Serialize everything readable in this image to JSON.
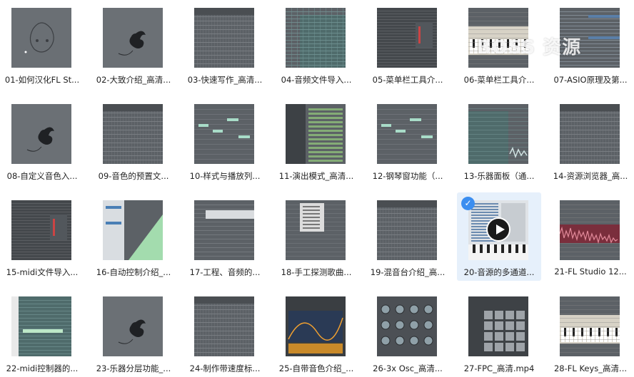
{
  "files": [
    {
      "name": "01-如何汉化FL St...",
      "thumb": "sketch"
    },
    {
      "name": "02-大致介绍_高清...",
      "thumb": "fruit"
    },
    {
      "name": "03-快速写作_高清...",
      "thumb": "tracks"
    },
    {
      "name": "04-音频文件导入...",
      "thumb": "teal-grid"
    },
    {
      "name": "05-菜单栏工具介...",
      "thumb": "mixer"
    },
    {
      "name": "06-菜单栏工具介...",
      "thumb": "keyboard"
    },
    {
      "name": "07-ASIO原理及第...",
      "thumb": "tracks-blue"
    },
    {
      "name": "08-自定义音色入...",
      "thumb": "fruit"
    },
    {
      "name": "09-音色的预置文...",
      "thumb": "tracks"
    },
    {
      "name": "10-样式与播放列...",
      "thumb": "notes"
    },
    {
      "name": "11-演出模式_高清...",
      "thumb": "browser"
    },
    {
      "name": "12-钢琴窗功能（...",
      "thumb": "notes"
    },
    {
      "name": "13-乐器面板（通...",
      "thumb": "teal-wave"
    },
    {
      "name": "14-资源浏览器_高...",
      "thumb": "tracks"
    },
    {
      "name": "15-midi文件导入...",
      "thumb": "mixer"
    },
    {
      "name": "16-自动控制介绍_...",
      "thumb": "automation"
    },
    {
      "name": "17-工程、音频的...",
      "thumb": "tracks-white"
    },
    {
      "name": "18-手工探测歌曲...",
      "thumb": "menu"
    },
    {
      "name": "19-混音台介绍_高...",
      "thumb": "tracks"
    },
    {
      "name": "20-音源的多通道...",
      "thumb": "plugin",
      "selected": true
    },
    {
      "name": "21-FL Studio 12...",
      "thumb": "waveform"
    },
    {
      "name": "22-midi控制器的...",
      "thumb": "notes-green"
    },
    {
      "name": "23-乐器分层功能_...",
      "thumb": "fruit"
    },
    {
      "name": "24-制作带速度标...",
      "thumb": "tracks"
    },
    {
      "name": "25-自带音色介绍_...",
      "thumb": "synth"
    },
    {
      "name": "26-3x Osc_高清...",
      "thumb": "knobs"
    },
    {
      "name": "27-FPC_高清.mp4",
      "thumb": "pads"
    },
    {
      "name": "28-FL Keys_高清...",
      "thumb": "keyboard"
    }
  ],
  "watermark": "BOSS 资源",
  "colors": {
    "accent": "#3b8ef0",
    "selected_bg": "#e6f0fb"
  },
  "icons": {
    "selected": "check-icon",
    "play": "play-icon"
  }
}
